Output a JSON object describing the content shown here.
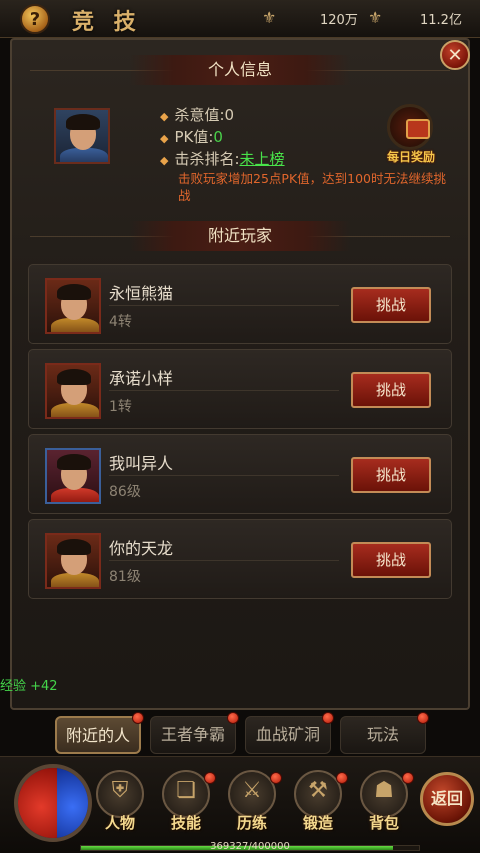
{
  "header": {
    "title": "竞 技",
    "help_label": "?",
    "currency1": {
      "icon": "coin-icon",
      "value": "120万"
    },
    "currency2": {
      "icon": "gold-icon",
      "value": "11.2亿"
    }
  },
  "personal": {
    "header": "个人信息",
    "kill_intent_label": "杀意值:",
    "kill_intent_value": "0",
    "pk_label": "PK值:",
    "pk_value": "0",
    "rank_label": "击杀排名:",
    "rank_value": "未上榜",
    "warning": "击败玩家增加25点PK值，达到100时无法继续挑战",
    "daily_reward_label": "每日奖励"
  },
  "nearby": {
    "header": "附近玩家",
    "challenge_label": "挑战",
    "players": [
      {
        "name": "永恒熊猫",
        "level": "4转"
      },
      {
        "name": "承诺小样",
        "level": "1转"
      },
      {
        "name": "我叫异人",
        "level": "86级"
      },
      {
        "name": "你的天龙",
        "level": "81级"
      }
    ]
  },
  "exp_float": "经验 +42",
  "tabs": [
    "附近的人",
    "王者争霸",
    "血战矿洞",
    "玩法"
  ],
  "bottom_menu": [
    "人物",
    "技能",
    "历练",
    "锻造",
    "背包"
  ],
  "back_label": "返回",
  "xp": {
    "text": "369327/400000",
    "fraction": 0.923
  },
  "colors": {
    "accent_red": "#a72c1e",
    "highlight_green": "#49d24a",
    "warning_orange": "#e0662c"
  }
}
